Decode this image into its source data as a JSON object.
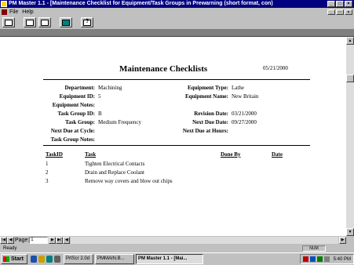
{
  "window": {
    "title": "PM Master 1.1 - [Maintenance Checklist for Equipment/Task Groups in Prewarning (short format, con)",
    "btn_min": "_",
    "btn_max": "□",
    "btn_close": "×"
  },
  "menu": {
    "items": [
      "File",
      "Help"
    ]
  },
  "report": {
    "title": "Maintenance Checklists",
    "date": "05/21/2000",
    "fields": {
      "department_label": "Department:",
      "department_value": "Machining",
      "equipment_id_label": "Equipment ID:",
      "equipment_id_value": "5",
      "equipment_notes_label": "Equipment Notes:",
      "task_group_id_label": "Task Group ID:",
      "task_group_id_value": "B",
      "task_group_label": "Task Group:",
      "task_group_value": "Medium Frequency",
      "next_due_cycle_label": "Next Due at Cycle:",
      "task_group_notes_label": "Task Group Notes:",
      "equipment_type_label": "Equipment Type:",
      "equipment_type_value": "Lathe",
      "equipment_name_label": "Equipment Name:",
      "equipment_name_value": "New Britain",
      "revision_date_label": "Revision Date:",
      "revision_date_value": "03/21/2000",
      "next_due_date_label": "Next Due Date:",
      "next_due_date_value": "09/27/2000",
      "next_due_hours_label": "Next Due at Hours:"
    },
    "columns": [
      "TaskID",
      "Task",
      "Done By",
      "Date"
    ],
    "tasks": [
      {
        "id": "1",
        "task": "Tighten Electrical Contacts"
      },
      {
        "id": "2",
        "task": "Drain and Replace Coolant"
      },
      {
        "id": "3",
        "task": "Remove way covers and blow out chips"
      }
    ]
  },
  "nav": {
    "page_label": "Page:",
    "page_value": "1"
  },
  "status": {
    "text": "Ready",
    "num": "NUM"
  },
  "taskbar": {
    "start": "Start",
    "buttons": [
      "PrtScr 2.0d",
      "PMMAIN.B...",
      "PM Master 1.1 - [Mai..."
    ],
    "clock": "5:40 PM"
  },
  "colors": {
    "titlebar": "#000080",
    "desktop": "#008080",
    "face": "#c0c0c0"
  }
}
